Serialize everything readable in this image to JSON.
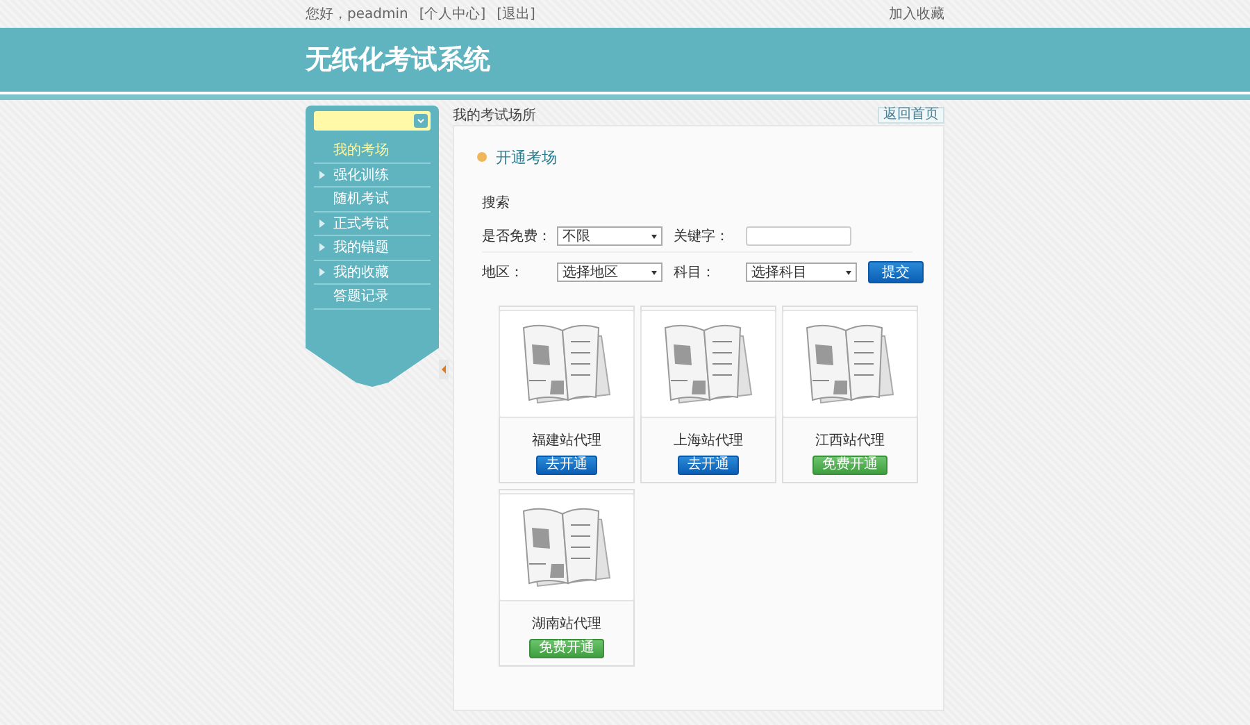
{
  "top_bar": {
    "greeting": "您好，peadmin",
    "links": [
      "[个人中心]",
      "[退出]"
    ],
    "favorite": "加入收藏"
  },
  "header": {
    "title": "无纸化考试系统"
  },
  "sidebar": {
    "items": [
      {
        "label": "我的考场",
        "selected": true,
        "expandable": false
      },
      {
        "label": "强化训练",
        "selected": false,
        "expandable": true
      },
      {
        "label": "随机考试",
        "selected": false,
        "expandable": false
      },
      {
        "label": "正式考试",
        "selected": false,
        "expandable": true
      },
      {
        "label": "我的错题",
        "selected": false,
        "expandable": true
      },
      {
        "label": "我的收藏",
        "selected": false,
        "expandable": true
      },
      {
        "label": "答题记录",
        "selected": false,
        "expandable": false
      }
    ]
  },
  "breadcrumb": "我的考试场所",
  "home_button": "返回首页",
  "section_title": "开通考场",
  "search": {
    "heading": "搜索",
    "free_label": "是否免费：",
    "free_value": "不限",
    "keyword_label": "关键字：",
    "region_label": "地区：",
    "region_value": "选择地区",
    "subject_label": "科目：",
    "subject_value": "选择科目",
    "submit": "提交"
  },
  "cards": [
    {
      "name": "福建站代理",
      "button": "去开通",
      "kind": "paid"
    },
    {
      "name": "上海站代理",
      "button": "去开通",
      "kind": "paid"
    },
    {
      "name": "江西站代理",
      "button": "免费开通",
      "kind": "free"
    },
    {
      "name": "湖南站代理",
      "button": "免费开通",
      "kind": "free"
    }
  ]
}
